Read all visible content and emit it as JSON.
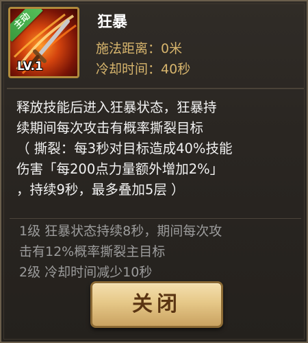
{
  "skill": {
    "badge": "主动",
    "level": "LV.1",
    "name": "狂暴",
    "range_label": "施法距离：",
    "range_value": "0米",
    "cooldown_label": "冷却时间：",
    "cooldown_value": "40秒"
  },
  "description": {
    "lines": [
      "释放技能后进入狂暴状态，狂暴持",
      "续期间每次攻击有概率撕裂目标",
      "（ 撕裂：每3秒对目标造成40%技能",
      "伤害「每200点力量额外增加2%」",
      "，持续9秒，最多叠加5层 ）"
    ]
  },
  "upgrades": {
    "lines": [
      "1级 狂暴状态持续8秒，期间每次攻",
      "击有12%概率撕裂主目标",
      "2级 冷却时间减少10秒"
    ]
  },
  "buttons": {
    "close_label": "关闭"
  },
  "colors": {
    "accent_gold": "#d7b56d",
    "badge_green": "#3a9a3e",
    "button_text": "#5a3412"
  }
}
